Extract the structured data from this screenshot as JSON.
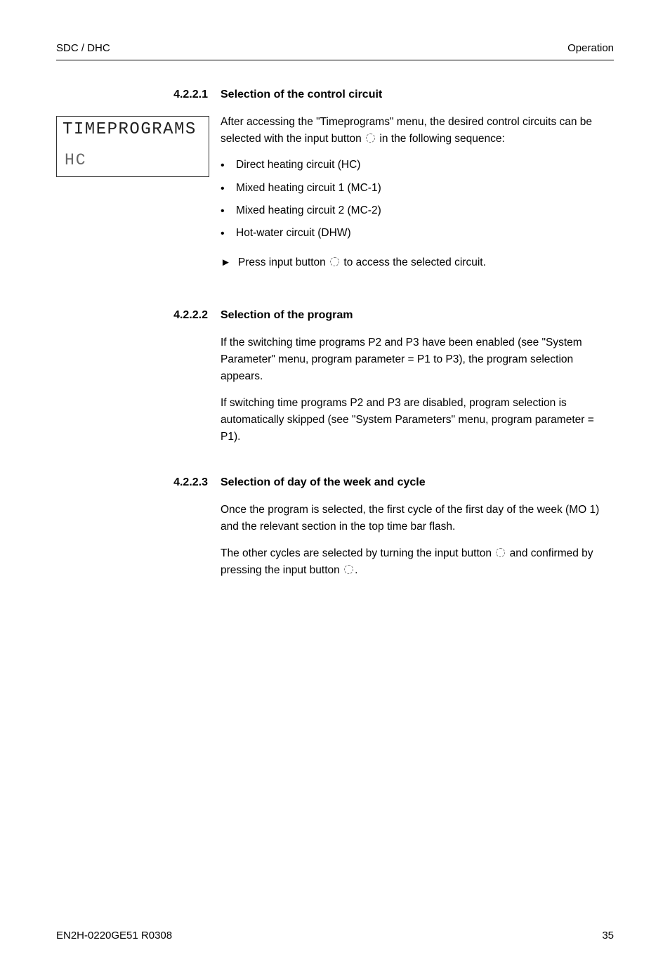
{
  "header": {
    "left": "SDC / DHC",
    "right": "Operation"
  },
  "section1": {
    "number": "4.2.2.1",
    "title": "Selection of the control circuit",
    "lcd_line1": "TIMEPROGRAMS",
    "lcd_line2": "HC",
    "intro": "After accessing the \"Timeprograms\" menu, the desired control circuits can be selected with the input button ",
    "intro_tail": " in the following sequence:",
    "bullets": [
      "Direct heating circuit (HC)",
      "Mixed heating circuit 1 (MC-1)",
      "Mixed heating circuit 2 (MC-2)",
      "Hot-water circuit (DHW)"
    ],
    "action_pre": "Press input button ",
    "action_post": " to access the selected circuit."
  },
  "section2": {
    "number": "4.2.2.2",
    "title": "Selection of the program",
    "p1": "If the switching time programs P2 and P3 have been enabled (see \"System Parameter\" menu, program parameter = P1 to P3), the program selection appears.",
    "p2": "If switching time programs P2 and P3 are disabled, program selection is automatically skipped (see \"System Parameters\" menu, program parameter = P1)."
  },
  "section3": {
    "number": "4.2.2.3",
    "title": "Selection of day of the week and cycle",
    "p1": "Once the program is selected, the first cycle of the first day of the week (MO 1) and the relevant section in the top time bar flash.",
    "p2_a": "The other cycles are selected by turning the input button ",
    "p2_b": " and confirmed by pressing the input button ",
    "p2_c": "."
  },
  "footer": {
    "left": "EN2H-0220GE51 R0308",
    "right": "35"
  }
}
